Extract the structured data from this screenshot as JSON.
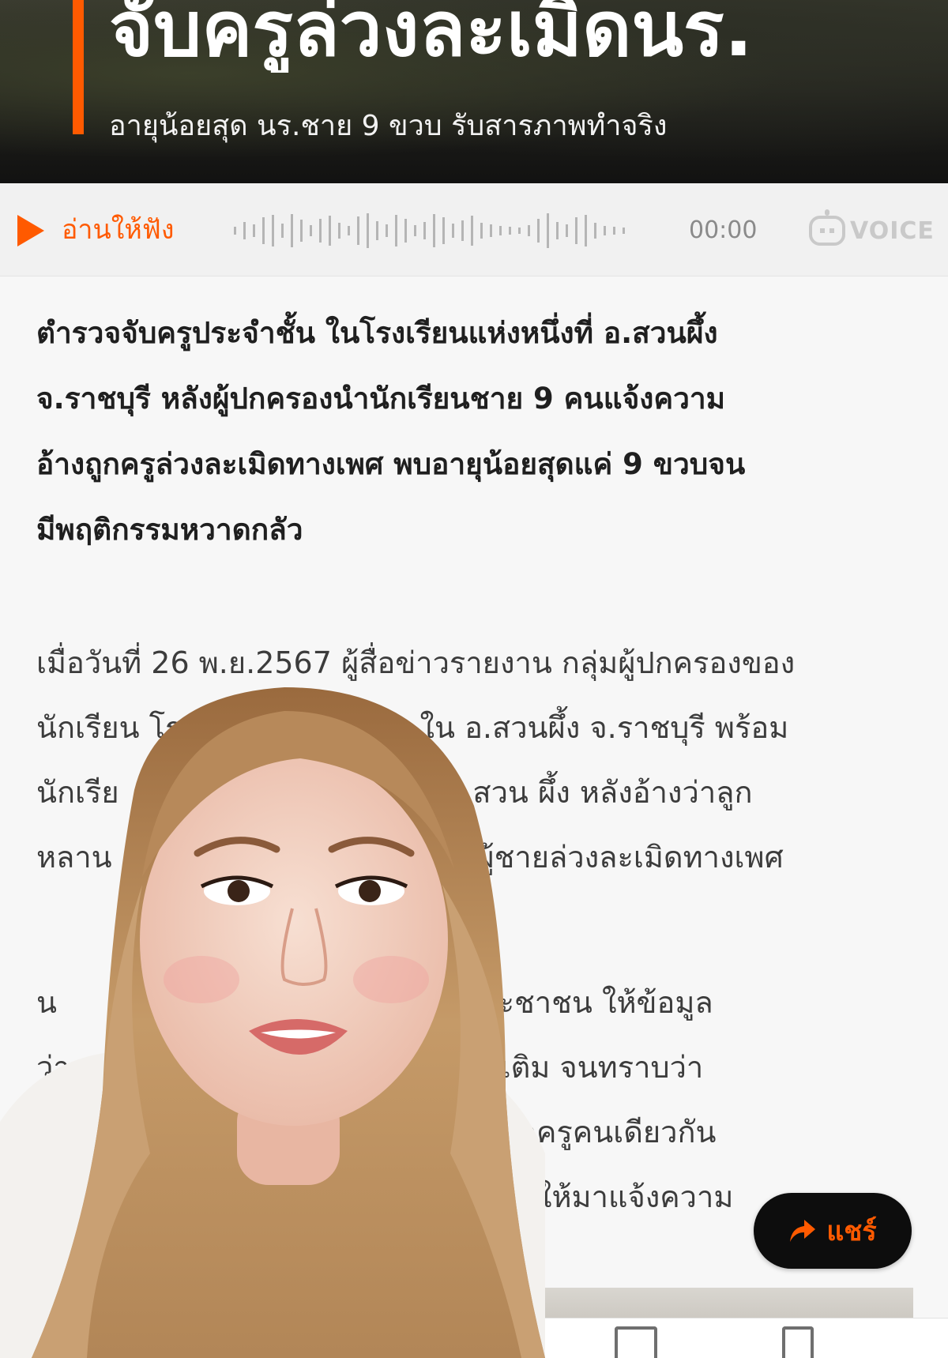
{
  "hero": {
    "title": "จับครูล่วงละเมิดนร.",
    "subtitle": "อายุน้อยสุด นร.ชาย 9 ขวบ รับสารภาพทำจริง"
  },
  "audio": {
    "listen_label": "อ่านให้ฟัง",
    "time": "00:00",
    "brand": "VOICE"
  },
  "article": {
    "lead_lines": [
      "ตำรวจจับครูประจำชั้น ในโรงเรียนแห่งหนึ่งที่ อ.สวนผึ้ง",
      "จ.ราชบุรี หลังผู้ปกครองนำนักเรียนชาย 9 คนแจ้งความ",
      "อ้างถูกครูล่วงละเมิดทางเพศ พบอายุน้อยสุดแค่ 9 ขวบจน",
      "มีพฤติกรรมหวาดกลัว"
    ],
    "body_lines": [
      "เมื่อวันที่ 26 พ.ย.2567 ผู้สื่อข่าวรายงาน กลุ่มผู้ปกครองของ",
      "นักเรียน โร                         ใน อ.สวนผึ้ง จ.ราชบุรี พร้อม",
      "นักเรีย                             ที่ สภ.สวน ผึ้ง หลังอ้างว่าลูก",
      "หลาน                                 เป็นผู้ชายล่วงละเมิดทางเพศ"
    ],
    "para2_lines": [
      "น                                   พรรคประชาชน ให้ข้อมูล",
      "ว่า                                  อมูลเพิ่มเติม จนทราบว่า",
      "เรื่อ                                  ายคนที่ถูกครูคนเดียวกัน",
      "                                     หายทั้งหมดให้มาแจ้งความ"
    ]
  },
  "share": {
    "label": "แชร์"
  },
  "colors": {
    "accent": "#ff5a00",
    "share_bg": "#0d0d0d"
  },
  "icons": [
    "play-icon",
    "voice-robot-icon",
    "share-arrow-icon"
  ]
}
